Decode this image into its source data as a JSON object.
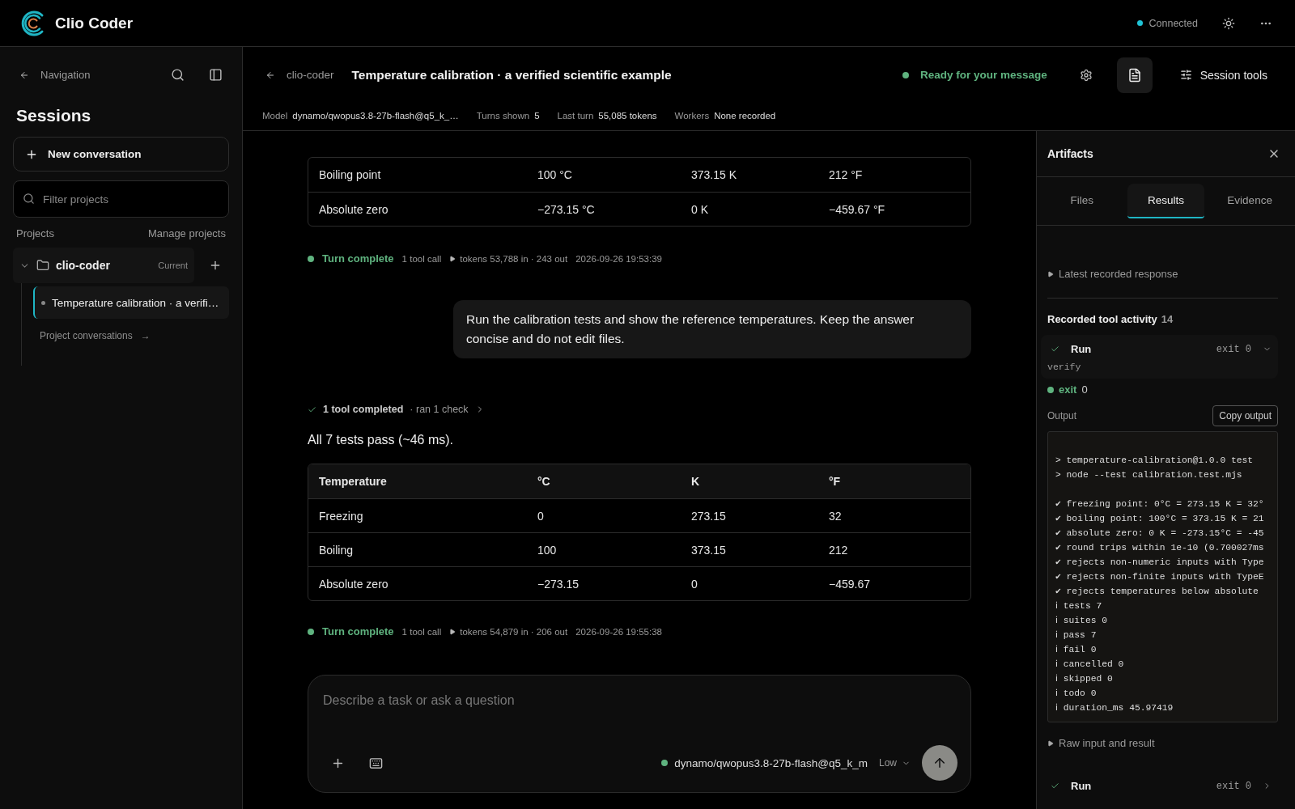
{
  "app": {
    "name": "Clio Coder",
    "connection": "Connected"
  },
  "sidebar": {
    "back_label": "Navigation",
    "title": "Sessions",
    "new_button": "New conversation",
    "filter": {
      "placeholder": "Filter projects"
    },
    "projects_label": "Projects",
    "manage_label": "Manage projects",
    "projects": [
      {
        "name": "clio-coder",
        "badge": "Current",
        "expanded": true,
        "conversations": [
          {
            "title": "Temperature calibration · a verifi…",
            "selected": true
          }
        ],
        "more_link": "Project conversations",
        "more_arrow": "→"
      }
    ]
  },
  "header": {
    "back": "clio-coder",
    "title": "Temperature calibration · a verified scientific example",
    "status": "Ready for your message",
    "tools_label": "Session tools",
    "meta": [
      {
        "label": "Model",
        "value": "dynamo/qwopus3.8-27b-flash@q5_k_…"
      },
      {
        "label": "Turns shown",
        "value": "5"
      },
      {
        "label": "Last turn",
        "value": "55,085 tokens"
      },
      {
        "label": "Workers",
        "value": "None recorded"
      }
    ]
  },
  "conversation": [
    {
      "kind": "table",
      "rows": [
        [
          "Boiling point",
          "100 °C",
          "373.15 K",
          "212 °F"
        ],
        [
          "Absolute zero",
          "−273.15 °C",
          "0 K",
          "−459.67 °F"
        ]
      ]
    },
    {
      "kind": "turn",
      "status": "Turn complete",
      "calls": "1 tool call",
      "tokens": "tokens 53,788 in · 243 out",
      "time": "2026-09-26 19:53:39"
    },
    {
      "kind": "user",
      "text": "Run the calibration tests and show the reference temperatures. Keep the answer concise and do not edit files."
    },
    {
      "kind": "tools",
      "label": "1 tool completed",
      "detail": "· ran 1 check"
    },
    {
      "kind": "text",
      "text": "All 7 tests pass (~46 ms)."
    },
    {
      "kind": "table",
      "columns": [
        "Temperature",
        "°C",
        "K",
        "°F"
      ],
      "rows": [
        [
          "Freezing",
          "0",
          "273.15",
          "32"
        ],
        [
          "Boiling",
          "100",
          "373.15",
          "212"
        ],
        [
          "Absolute zero",
          "−273.15",
          "0",
          "−459.67"
        ]
      ]
    },
    {
      "kind": "turn",
      "status": "Turn complete",
      "calls": "1 tool call",
      "tokens": "tokens 54,879 in · 206 out",
      "time": "2026-09-26 19:55:38"
    }
  ],
  "composer": {
    "placeholder": "Describe a task or ask a question",
    "model": "dynamo/qwopus3.8-27b-flash@q5_k_m",
    "effort": "Low"
  },
  "artifacts": {
    "title": "Artifacts",
    "tabs": [
      {
        "label": "Files",
        "selected": false
      },
      {
        "label": "Results",
        "selected": true
      },
      {
        "label": "Evidence",
        "selected": false
      }
    ],
    "latest": {
      "label": "Latest recorded response",
      "expanded": false
    },
    "activity_title": "Recorded tool activity",
    "activity_count": "14",
    "runs": [
      {
        "name": "Run",
        "exit": "exit 0",
        "expanded": true,
        "command": "verify",
        "result_label": "exit",
        "result_value": "0",
        "output_label": "Output",
        "copy_button": "Copy output",
        "output": [
          [
            "> temperature-calibration@1.0.0 test",
            "> node --test calibration.test.mjs"
          ],
          [
            "✔ freezing point: 0°C = 273.15 K = 32°",
            "✔ boiling point: 100°C = 373.15 K = 21",
            "✔ absolute zero: 0 K = -273.15°C = -45",
            "✔ round trips within 1e-10 (0.700027ms",
            "✔ rejects non-numeric inputs with Type",
            "✔ rejects non-finite inputs with TypeE",
            "✔ rejects temperatures below absolute",
            "ℹ tests 7",
            "ℹ suites 0",
            "ℹ pass 7",
            "ℹ fail 0",
            "ℹ cancelled 0",
            "ℹ skipped 0",
            "ℹ todo 0",
            "ℹ duration_ms 45.97419"
          ]
        ],
        "raw": {
          "label": "Raw input and result",
          "expanded": false
        }
      },
      {
        "name": "Run",
        "exit": "exit 0",
        "expanded": false
      }
    ]
  }
}
